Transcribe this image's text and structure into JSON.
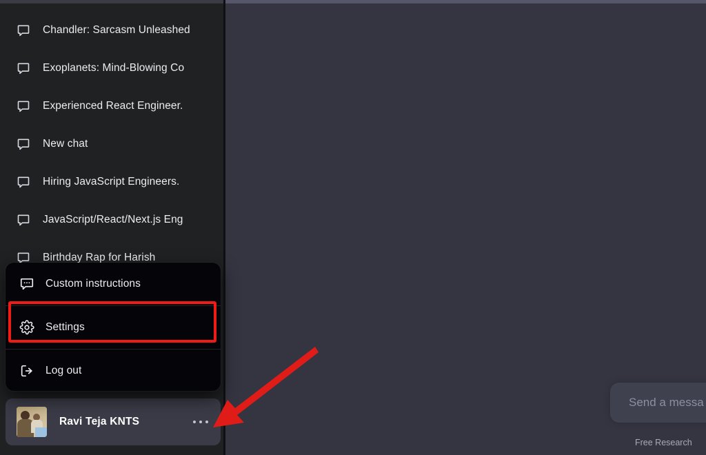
{
  "theme": {
    "main_bg": "#343541",
    "sidebar_bg": "#202123",
    "menu_bg": "#050509",
    "user_row_bg": "#3a3b47",
    "composer_bg": "#40414f",
    "annotation_red": "#ee1b17",
    "text_primary": "#ececf1",
    "text_muted": "#8e8ea0"
  },
  "sidebar": {
    "chats": [
      {
        "label": "Chandler: Sarcasm Unleashed",
        "icon": "chat-bubble-icon"
      },
      {
        "label": "Exoplanets: Mind-Blowing Co",
        "icon": "chat-bubble-icon"
      },
      {
        "label": "Experienced React Engineer.",
        "icon": "chat-bubble-icon"
      },
      {
        "label": "New chat",
        "icon": "chat-bubble-icon"
      },
      {
        "label": "Hiring JavaScript Engineers.",
        "icon": "chat-bubble-icon"
      },
      {
        "label": "JavaScript/React/Next.js Eng",
        "icon": "chat-bubble-icon"
      },
      {
        "label": "Birthday Rap for Harish",
        "icon": "chat-bubble-icon"
      }
    ]
  },
  "account_menu": {
    "items": [
      {
        "label": "Custom instructions",
        "icon": "chat-bubble-dots-icon",
        "highlighted": false
      },
      {
        "label": "Settings",
        "icon": "gear-icon",
        "highlighted": true
      },
      {
        "label": "Log out",
        "icon": "logout-icon",
        "highlighted": false
      }
    ]
  },
  "user_row": {
    "name": "Ravi Teja KNTS",
    "avatar_alt": "user-profile-photo",
    "more_label": "..."
  },
  "main": {
    "composer_placeholder": "Send a messa",
    "footnote": "Free Research "
  }
}
